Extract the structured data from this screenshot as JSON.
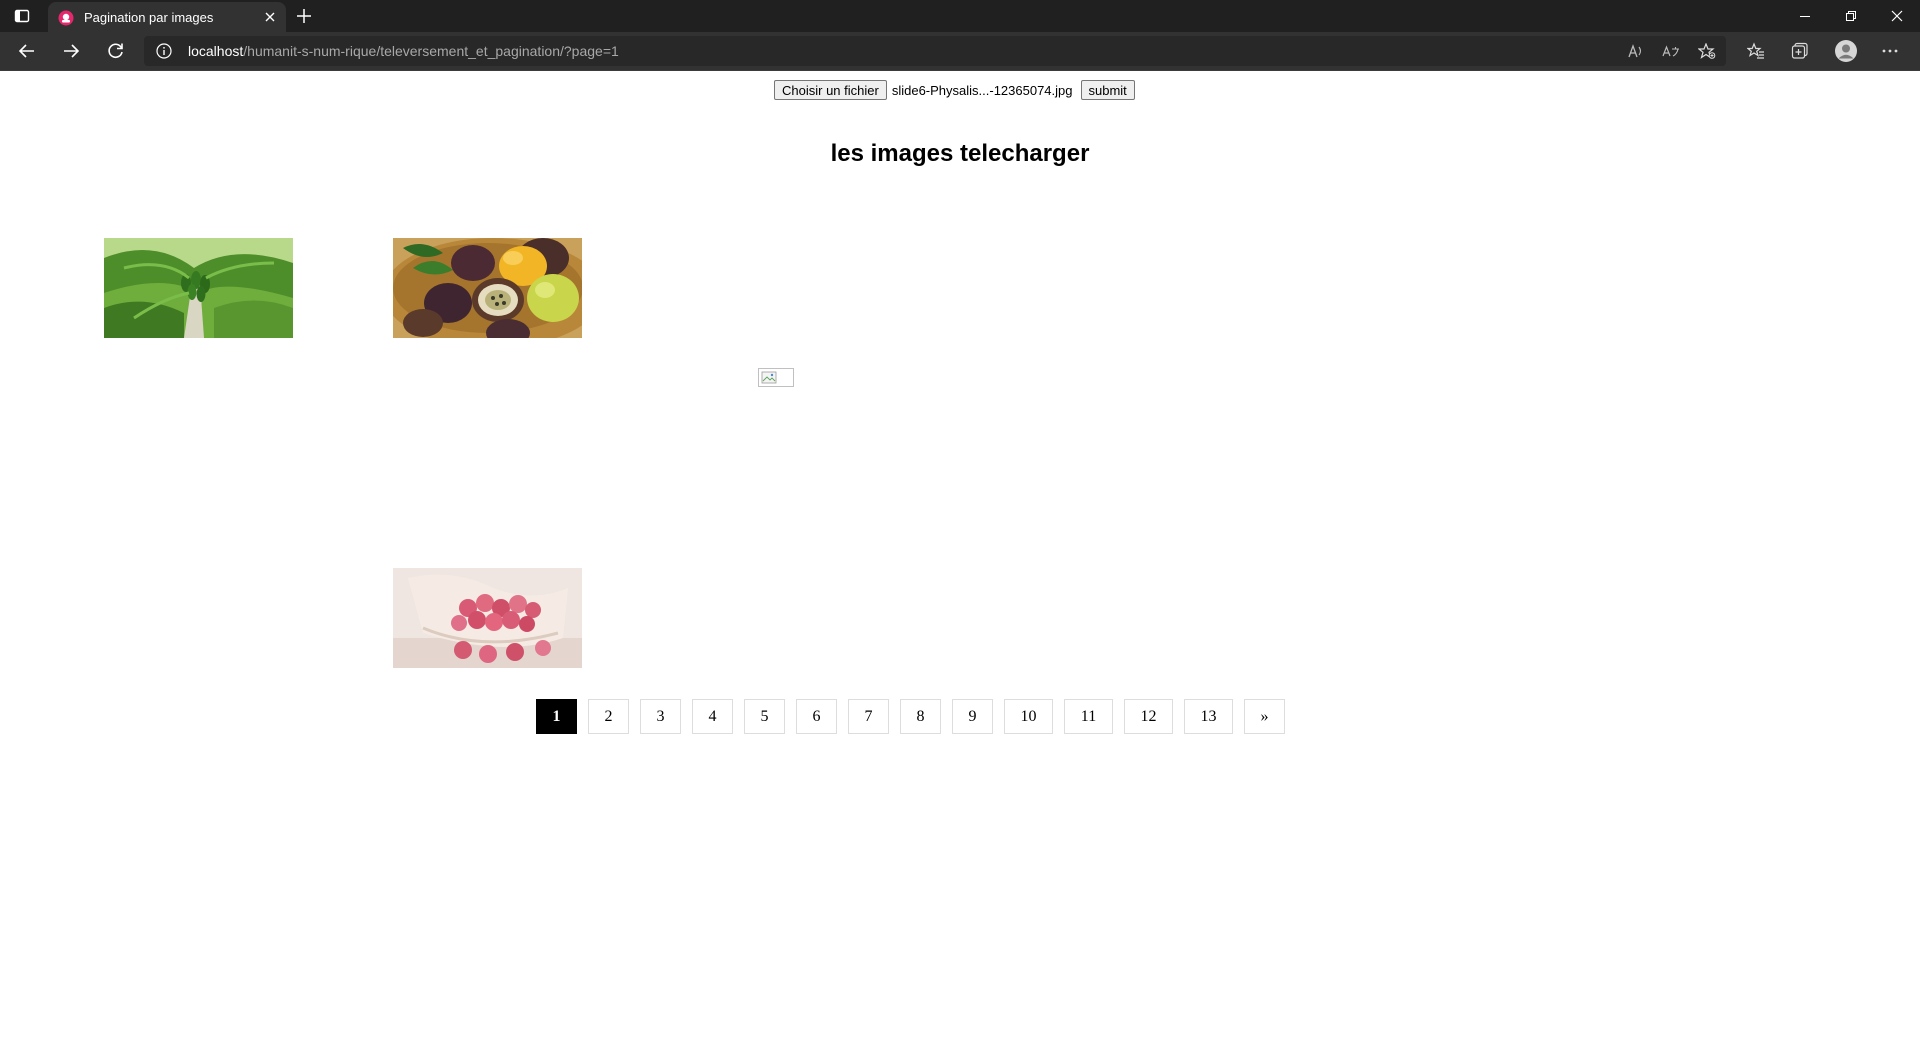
{
  "browser": {
    "tab_title": "Pagination par images",
    "url_host": "localhost",
    "url_path": "/humanit-s-num-rique/televersement_et_pagination/?page=1",
    "tab_color": "#e5286e"
  },
  "upload": {
    "choose_label": "Choisir un fichier",
    "file_name": "slide6-Physalis...-12365074.jpg",
    "submit_label": "submit"
  },
  "heading": "les images telecharger",
  "images": [
    {
      "subject": "papaya tree"
    },
    {
      "subject": "passion fruits"
    },
    {
      "subject": "broken image"
    },
    {
      "subject": "lychees in bowl"
    }
  ],
  "pagination": {
    "pages": [
      "1",
      "2",
      "3",
      "4",
      "5",
      "6",
      "7",
      "8",
      "9",
      "10",
      "11",
      "12",
      "13"
    ],
    "next": "»",
    "current": "1",
    "active_color": "#000000"
  }
}
